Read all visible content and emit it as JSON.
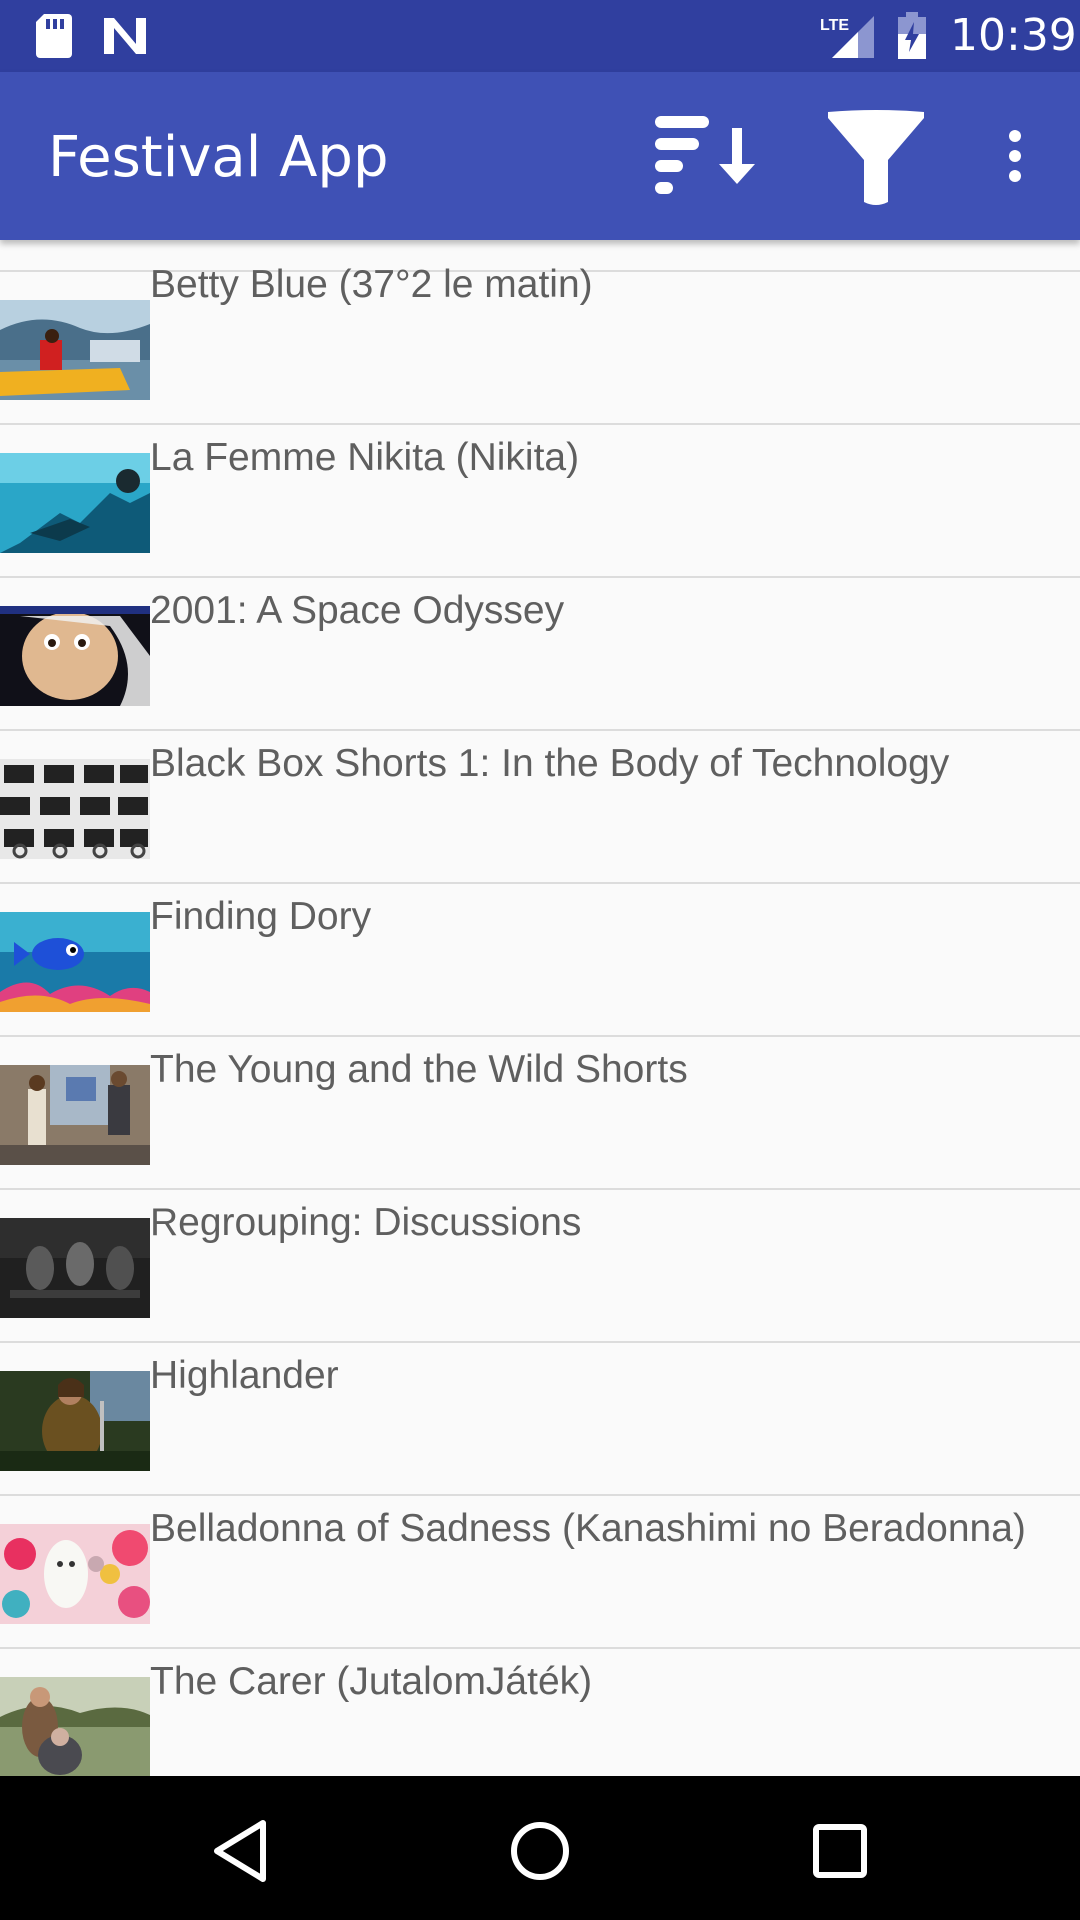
{
  "status_bar": {
    "time": "10:39",
    "network_label": "LTE",
    "icons": [
      "sd-card-icon",
      "n-logo-icon",
      "lte-signal-icon",
      "battery-charging-icon"
    ]
  },
  "app_bar": {
    "title": "Festival App",
    "actions": [
      "sort-icon",
      "filter-icon",
      "more-vert-icon"
    ],
    "color": "#3f51b5",
    "status_color": "#303f9f"
  },
  "films": [
    {
      "title": "Betty Blue (37°2 le matin)"
    },
    {
      "title": "La Femme Nikita (Nikita)"
    },
    {
      "title": "2001: A Space Odyssey"
    },
    {
      "title": "Black Box Shorts 1: In the Body of Technology"
    },
    {
      "title": "Finding Dory"
    },
    {
      "title": "The Young and the Wild Shorts"
    },
    {
      "title": "Regrouping: Discussions"
    },
    {
      "title": "Highlander"
    },
    {
      "title": "Belladonna of Sadness (Kanashimi no Beradonna)"
    },
    {
      "title": "The Carer (JutalomJáték)"
    }
  ],
  "nav_bar": {
    "buttons": [
      "back-icon",
      "home-icon",
      "recents-icon"
    ]
  }
}
